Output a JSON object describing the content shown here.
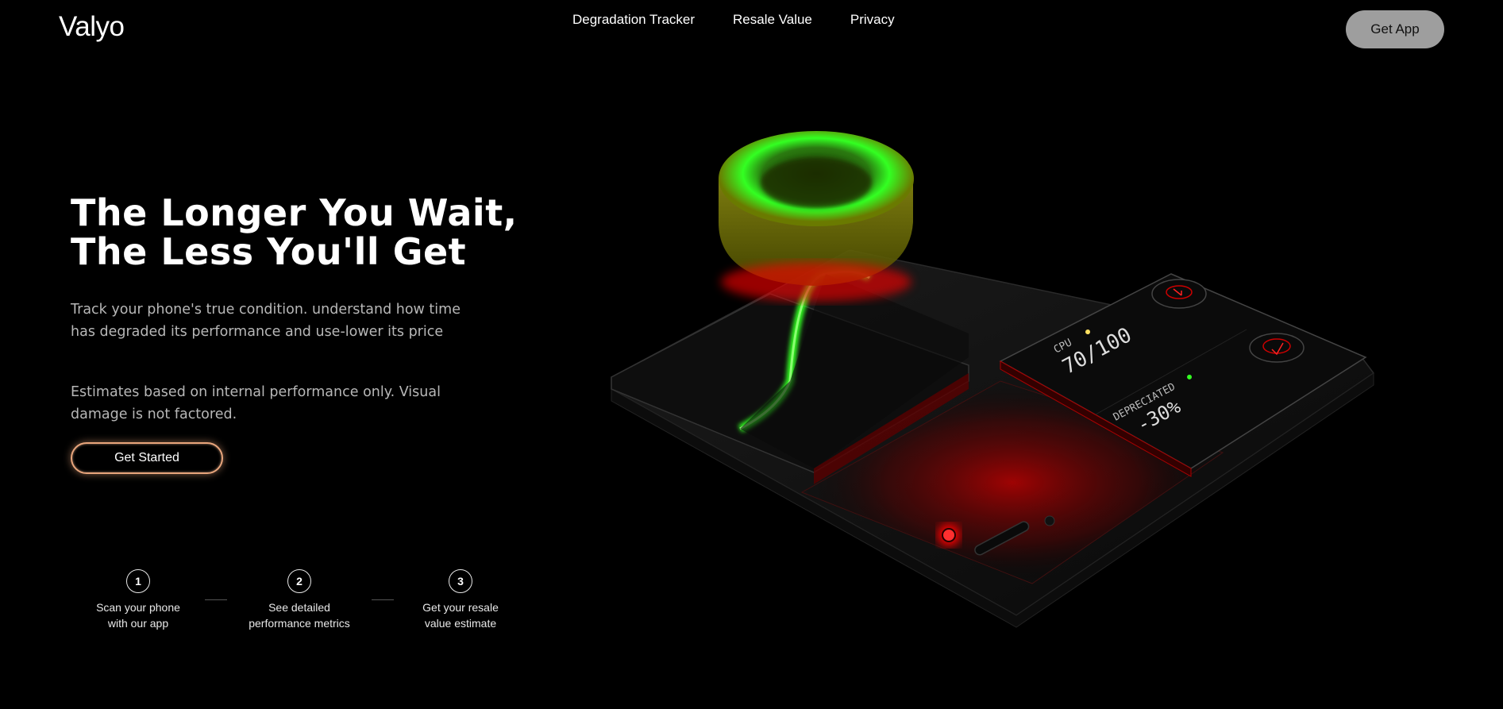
{
  "brand": {
    "logo": "Valyo"
  },
  "nav": {
    "items": [
      {
        "label": "Degradation Tracker"
      },
      {
        "label": "Resale Value"
      },
      {
        "label": "Privacy"
      }
    ],
    "cta": "Get App"
  },
  "hero": {
    "title_line1": "The Longer You Wait,",
    "title_line2": "The Less You'll Get",
    "description": "Track your phone's true condition. understand how time has degraded its performance and use-lower its price",
    "disclaimer": "Estimates based on internal performance only. Visual damage is not factored.",
    "cta": "Get Started"
  },
  "steps": [
    {
      "number": "1",
      "text": "Scan your phone\nwith our app"
    },
    {
      "number": "2",
      "text": "See detailed\nperformance metrics"
    },
    {
      "number": "3",
      "text": "Get your resale\nvalue estimate"
    }
  ],
  "device": {
    "cpu_label": "CPU",
    "cpu_value": "70/100",
    "depreciated_label": "DEPRECIATED",
    "depreciated_value": "-30%"
  },
  "colors": {
    "accent_green": "#32ff32",
    "accent_red": "#ff1a1a",
    "button_border": "#e8a57c",
    "get_app_bg": "#9e9e9e"
  }
}
